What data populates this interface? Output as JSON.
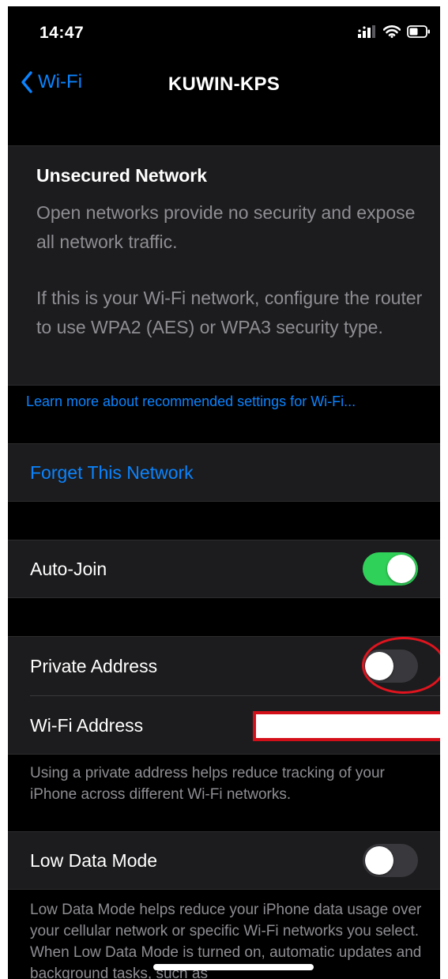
{
  "status_bar": {
    "time": "14:47"
  },
  "nav": {
    "back_label": "Wi-Fi",
    "title": "KUWIN-KPS"
  },
  "notice": {
    "title": "Unsecured Network",
    "body": "Open networks provide no security and expose all network traffic.",
    "body_2": "If this is your Wi-Fi network, configure the router to use WPA2 (AES) or WPA3 security type."
  },
  "learn_more": "Learn more about recommended settings for Wi-Fi...",
  "forget": "Forget This Network",
  "auto_join": {
    "label": "Auto-Join",
    "on": true
  },
  "private_address": {
    "label": "Private Address",
    "on": false
  },
  "wifi_address": {
    "label": "Wi-Fi Address"
  },
  "private_footnote": "Using a private address helps reduce tracking of your iPhone across different Wi-Fi networks.",
  "low_data": {
    "label": "Low Data Mode",
    "on": false
  },
  "low_data_footnote": "Low Data Mode helps reduce your iPhone data usage over your cellular network or specific Wi-Fi networks you select. When Low Data Mode is turned on, automatic updates and background tasks, such as",
  "colors": {
    "background": "#000000",
    "cell": "#1c1c1e",
    "accent": "#0a84ff",
    "toggle_on": "#30d158",
    "secondary_text": "#8e8e93",
    "annotation": "#e0141e"
  },
  "icons": {
    "back": "chevron-left-icon",
    "signal": "cellular-signal-icon",
    "wifi": "wifi-icon",
    "battery": "battery-icon"
  }
}
